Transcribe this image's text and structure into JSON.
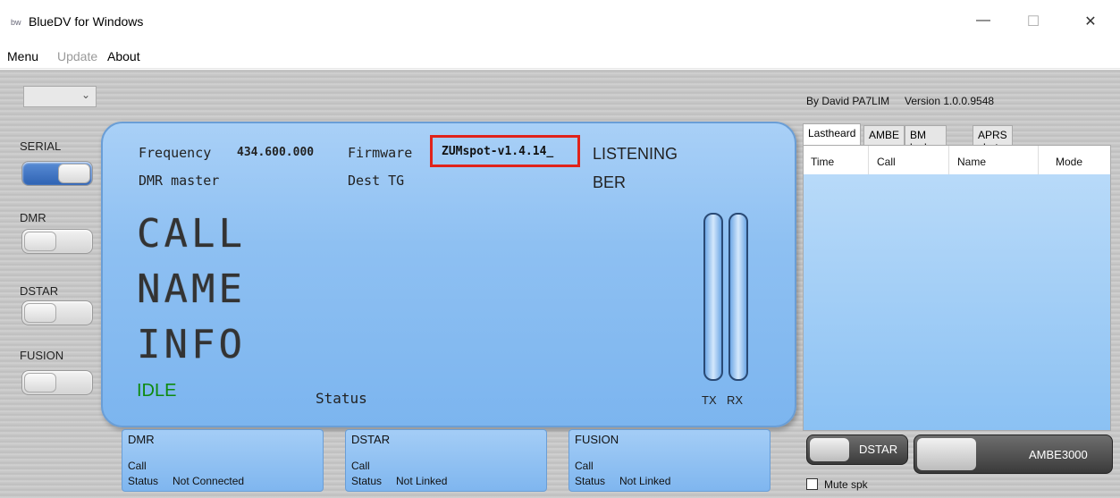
{
  "window": {
    "title": "BlueDV for Windows",
    "app_icon_text": "bw",
    "minimize": "—",
    "maximize": "☐",
    "close": "✕"
  },
  "menu": {
    "items": [
      "Menu",
      "Update",
      "About"
    ]
  },
  "left_controls": {
    "combo_value": "",
    "modes": [
      {
        "label": "SERIAL",
        "state": "on"
      },
      {
        "label": "DMR",
        "state": "off"
      },
      {
        "label": "DSTAR",
        "state": "off"
      },
      {
        "label": "FUSION",
        "state": "off"
      }
    ]
  },
  "display": {
    "frequency_label": "Frequency",
    "frequency_value": "434.600.000",
    "firmware_label": "Firmware",
    "firmware_value": "ZUMspot-v1.4.14_",
    "listening": "LISTENING",
    "dmr_master": "DMR master",
    "dest_tg": "Dest TG",
    "ber": "BER",
    "call": "CALL",
    "name": "NAME",
    "info": "INFO",
    "idle": "IDLE",
    "status": "Status",
    "tx": "TX",
    "rx": "RX"
  },
  "mini_panels": [
    {
      "title": "DMR",
      "call": "Call",
      "status_label": "Status",
      "status_value": "Not Connected"
    },
    {
      "title": "DSTAR",
      "call": "Call",
      "status_label": "Status",
      "status_value": "Not Linked"
    },
    {
      "title": "FUSION",
      "call": "Call",
      "status_label": "Status",
      "status_value": "Not Linked"
    }
  ],
  "right": {
    "byline": "By David PA7LIM",
    "version": "Version 1.0.0.9548",
    "tabs": [
      "Lastheard",
      "AMBE",
      "BM lookup",
      "APRS chat"
    ],
    "active_tab": "Lastheard",
    "columns": [
      "Time",
      "Call",
      "Name",
      "Mode"
    ],
    "dstar_button": "DSTAR",
    "ambe_button": "AMBE3000",
    "mute_label": "Mute spk",
    "mute_checked": false
  },
  "colors": {
    "panel_blue": "#8ec0f2",
    "firmware_highlight": "#e0231b",
    "idle_green": "#0e8a0e",
    "toggle_on": "#3a6fc0"
  }
}
